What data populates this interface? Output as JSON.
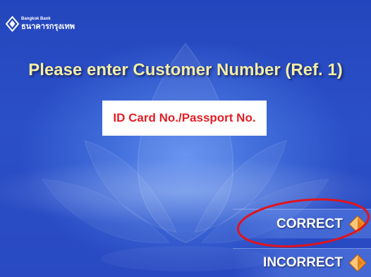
{
  "bank": {
    "name_en": "Bangkok Bank",
    "name_th": "ธนาคารกรุงเทพ",
    "logo_icon": "bangkok-bank-logo-icon"
  },
  "screen": {
    "title": "Please enter Customer Number (Ref. 1)",
    "input_prompt": "ID Card No./Passport No.",
    "watermark_icon": "lotus-watermark"
  },
  "options": [
    {
      "label": "CORRECT",
      "icon": "orange-arrow-icon",
      "highlighted": true
    },
    {
      "label": "INCORRECT",
      "icon": "orange-arrow-icon",
      "highlighted": false
    }
  ],
  "colors": {
    "background": "#2b4fc7",
    "title": "#f2eea6",
    "prompt_box": "#ffffff",
    "prompt_text": "#e31e24",
    "option_text": "#ffffff",
    "arrow": "#f0922a",
    "annotation": "#e0141c"
  }
}
